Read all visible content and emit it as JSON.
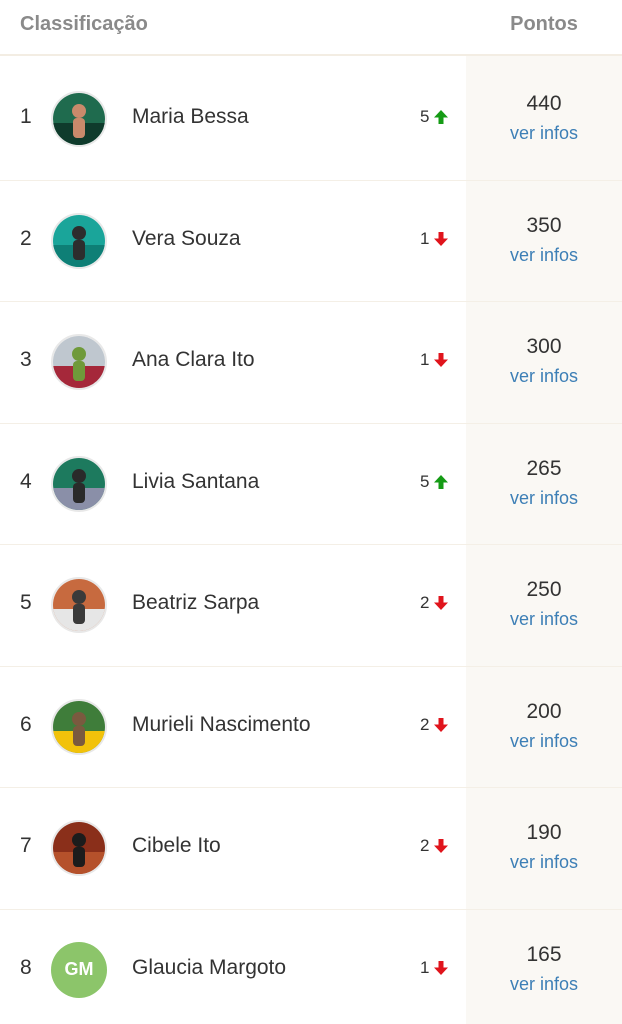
{
  "header": {
    "title": "Classificação",
    "points_title": "Pontos"
  },
  "colors": {
    "up": "#159b15",
    "down": "#e0141c",
    "link": "#3d7fb6",
    "initials_bg": "#8cc56a"
  },
  "ranking": [
    {
      "rank": "1",
      "name": "Maria Bessa",
      "change": "5",
      "direction": "up",
      "points": "440",
      "link": "ver infos",
      "avatar": "photo",
      "palette": [
        "#1f6b4e",
        "#0f3b2c",
        "#c98a6b"
      ]
    },
    {
      "rank": "2",
      "name": "Vera Souza",
      "change": "1",
      "direction": "down",
      "points": "350",
      "link": "ver infos",
      "avatar": "photo",
      "palette": [
        "#1aa59a",
        "#0e7f76",
        "#2d2d2d"
      ]
    },
    {
      "rank": "3",
      "name": "Ana Clara Ito",
      "change": "1",
      "direction": "down",
      "points": "300",
      "link": "ver infos",
      "avatar": "photo",
      "palette": [
        "#bfc7cf",
        "#a5283a",
        "#6f9a3a"
      ]
    },
    {
      "rank": "4",
      "name": "Livia Santana",
      "change": "5",
      "direction": "up",
      "points": "265",
      "link": "ver infos",
      "avatar": "photo",
      "palette": [
        "#1d7a5e",
        "#8a8fa8",
        "#2a2a2a"
      ]
    },
    {
      "rank": "5",
      "name": "Beatriz Sarpa",
      "change": "2",
      "direction": "down",
      "points": "250",
      "link": "ver infos",
      "avatar": "photo",
      "palette": [
        "#c76a3f",
        "#e6e6e6",
        "#3a3a3a"
      ]
    },
    {
      "rank": "6",
      "name": "Murieli Nascimento",
      "change": "2",
      "direction": "down",
      "points": "200",
      "link": "ver infos",
      "avatar": "photo",
      "palette": [
        "#3f7d3a",
        "#f2c20a",
        "#7a5a3f"
      ]
    },
    {
      "rank": "7",
      "name": "Cibele Ito",
      "change": "2",
      "direction": "down",
      "points": "190",
      "link": "ver infos",
      "avatar": "photo",
      "palette": [
        "#8a2f1a",
        "#b5512b",
        "#1c1c1c"
      ]
    },
    {
      "rank": "8",
      "name": "Glaucia Margoto",
      "change": "1",
      "direction": "down",
      "points": "165",
      "link": "ver infos",
      "avatar": "initials",
      "initials": "GM"
    }
  ]
}
